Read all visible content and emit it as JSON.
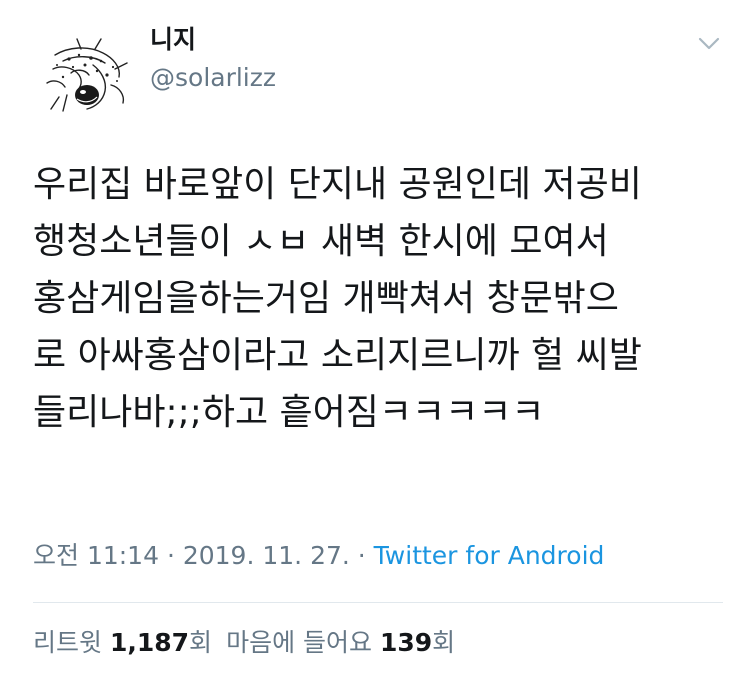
{
  "author": {
    "display_name": "니지",
    "handle": "@solarlizz"
  },
  "icons": {
    "avatar": "avatar-doodle-image",
    "menu": "chevron-down-icon"
  },
  "tweet": {
    "text_lines": [
      "우리집 바로앞이 단지내 공원인데 저공비",
      "행청소년들이 ㅅㅂ 새벽 한시에 모여서",
      "홍삼게임을하는거임 개빡쳐서 창문밖으",
      "로 아싸홍삼이라고 소리지르니까 헐 씨발",
      "들리나바;;;하고 흩어짐ㅋㅋㅋㅋㅋ"
    ]
  },
  "meta": {
    "time": "오전 11:14",
    "separator1": " · ",
    "date": "2019. 11. 27.",
    "separator2": " · ",
    "source": "Twitter for Android"
  },
  "stats": {
    "retweets_label": "리트윗",
    "retweets_count": "1,187",
    "retweets_unit": "회",
    "likes_label": "마음에 들어요",
    "likes_count": "139",
    "likes_unit": "회"
  },
  "colors": {
    "text_primary": "#14171a",
    "text_secondary": "#657786",
    "link": "#1b95e0",
    "divider": "#e1e8ed"
  }
}
